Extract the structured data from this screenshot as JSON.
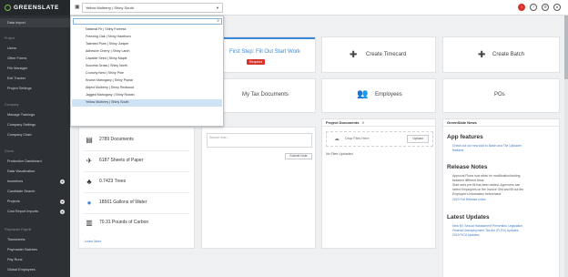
{
  "brand": {
    "name": "GREENSLATE"
  },
  "sidebar": {
    "top_item": "Data Import",
    "sections": [
      {
        "title": "Project",
        "items": [
          "Users",
          "Other Forms",
          "File Manager",
          "Exit Tracker",
          "Project Settings"
        ]
      },
      {
        "title": "Company",
        "items": [
          "Manage Trainings",
          "Company Settings",
          "Company Chart"
        ]
      },
      {
        "title": "Grove",
        "items": [
          "Production Dashboard",
          "Data Visualization",
          "Incentives",
          "Candidate Search",
          "Projects",
          "Cost Report Imports"
        ]
      },
      {
        "title": "Paymaster Payroll",
        "items": [
          "Timesheets",
          "Paymaster Batches",
          "Pay Runs",
          "Global Employees"
        ]
      }
    ]
  },
  "topbar": {
    "company_select": "Yellow Mulberry | Shiny South",
    "icons": [
      "alert-icon",
      "help-icon",
      "settings-icon",
      "user-icon"
    ]
  },
  "dropdown": {
    "search_placeholder": "",
    "options": [
      "National Fir | Shiny Fortress",
      "Freezing Oak | Shiny Hawthorn",
      "Talented Plum | Shiny Juniper",
      "Adhesive Cherry | Shiny Larch",
      "Capable Seed | Shiny Maple",
      "Success Grass | Shiny North",
      "Crunchy Nest | Shiny Pine",
      "Known Mahogany | Shiny Poplar",
      "Abject Mulberry | Shiny Redwood",
      "Jagged Mahogany | Shiny Rowan",
      "Yellow Mulberry | Shiny South"
    ],
    "selected_index": 10
  },
  "page": {
    "title": "Da"
  },
  "cards": {
    "first_step": "First Step: Fill Out Start Work",
    "required": "Required",
    "create_timecard": "Create Timecard",
    "create_batch": "Create Batch",
    "my_tax_docs": "My Tax Documents",
    "employees": "Employees",
    "pos": "POs"
  },
  "stats": [
    {
      "icon": "documents-icon",
      "glyph": "▤",
      "text": "2789 Documents"
    },
    {
      "icon": "paper-plane-icon",
      "glyph": "✈",
      "text": "6187 Sheets of Paper"
    },
    {
      "icon": "tree-icon",
      "glyph": "♣",
      "text": "0.7423 Trees"
    },
    {
      "icon": "water-drop-icon",
      "glyph": "💧",
      "text": "18561 Gallons of Water"
    },
    {
      "icon": "industry-icon",
      "glyph": "▥",
      "text": "70.31 Pounds of Carbon"
    }
  ],
  "learn_more": "Learn More",
  "notes": {
    "placeholder": "Secure note...",
    "submit": "Submit Note"
  },
  "project_docs": {
    "title": "Project Documents",
    "count": "0",
    "drop": "Drop Files Here",
    "upload": "Upload",
    "empty": "No Files Uploaded"
  },
  "news": {
    "header": "GreenSlate News",
    "app_features": "App features",
    "app_features_items": [
      "Check out our new Add to Batch and Tile Uploader",
      "features"
    ],
    "release_notes": "Release Notes",
    "release_items": [
      "Approval Flows now allow for modification/locking",
      "between different flows",
      "Start work pre-fill has been added. Approvers can",
      "select Employees on the Invoice Grid and fill out the",
      "Employee's information beforehand",
      "2019 Full Release notes"
    ],
    "latest_updates": "Latest Updates",
    "latest_items": [
      "New NY Sexual Harassment Prevention Legislation",
      "Federal Unemployment Tax Act (FUTA) Updates",
      "2019 FICA Updates"
    ]
  }
}
